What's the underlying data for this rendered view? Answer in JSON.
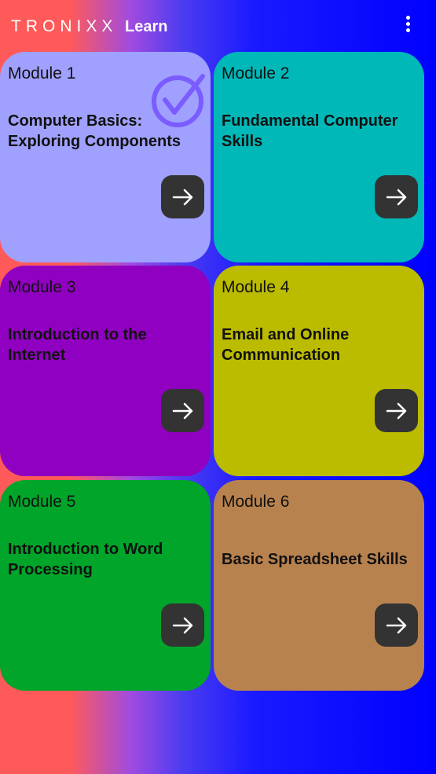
{
  "header": {
    "brand": "TRONIXX",
    "section": "Learn",
    "menu_icon": "more-vertical-icon"
  },
  "modules": [
    {
      "label": "Module 1",
      "title": "Computer Basics: Exploring Components",
      "color": "#a0a0ff",
      "completed": true,
      "button_icon": "arrow-right-icon"
    },
    {
      "label": "Module 2",
      "title": "Fundamental Computer Skills",
      "color": "#00b8b8",
      "completed": false,
      "button_icon": "arrow-right-icon"
    },
    {
      "label": "Module 3",
      "title": "Introduction to the Internet",
      "color": "#9000c0",
      "completed": false,
      "button_icon": "arrow-right-icon"
    },
    {
      "label": "Module 4",
      "title": "Email and Online Communication",
      "color": "#bbbb00",
      "completed": false,
      "button_icon": "arrow-right-icon"
    },
    {
      "label": "Module 5",
      "title": "Introduction to Word Processing",
      "color": "#00a52a",
      "completed": false,
      "button_icon": "arrow-right-icon"
    },
    {
      "label": "Module 6",
      "title": "Basic Spreadsheet Skills",
      "color": "#b8824f",
      "completed": false,
      "button_icon": "arrow-right-icon"
    }
  ],
  "colors": {
    "button_bg": "#333333",
    "check_color": "#7a5cff",
    "text": "#111111"
  }
}
